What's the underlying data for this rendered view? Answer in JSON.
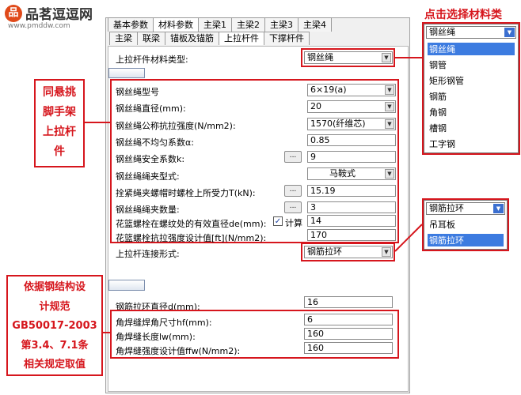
{
  "brand": {
    "badge": "品",
    "title": "品茗逗逗网",
    "url": "www.pmddw.com"
  },
  "tabs_top": [
    "基本参数",
    "材料参数",
    "主梁1",
    "主梁2",
    "主梁3",
    "主梁4"
  ],
  "tabs_sub": [
    "主梁",
    "联梁",
    "锚板及锚筋",
    "上拉杆件",
    "下撑杆件"
  ],
  "form": {
    "material_type_label": "上拉杆件材料类型:",
    "material_type_value": "钢丝绳",
    "rope_model_label": "钢丝绳型号",
    "rope_model_value": "6×19(a)",
    "rope_diameter_label": "钢丝绳直径(mm):",
    "rope_diameter_value": "20",
    "rope_strength_label": "钢丝绳公称抗拉强度(N/mm2):",
    "rope_strength_value": "1570(纤维芯)",
    "uneven_label": "钢丝绳不均匀系数α:",
    "uneven_value": "0.85",
    "safety_label": "钢丝绳安全系数k:",
    "safety_value": "9",
    "clamp_type_label": "钢丝绳绳夹型式:",
    "clamp_type_value": "马鞍式",
    "tension_label": "拴紧绳夹螺帽时螺栓上所受力T(kN):",
    "tension_value": "15.19",
    "clamp_count_label": "钢丝绳绳夹数量:",
    "clamp_count_value": "3",
    "thread_dia_label": "花篮螺栓在螺纹处的有效直径de(mm):",
    "calc_label": "计算",
    "thread_dia_value": "14",
    "bolt_strength_label": "花篮螺栓抗拉强度设计值[ft](N/mm2):",
    "bolt_strength_value": "170",
    "connect_label": "上拉杆连接形式:",
    "connect_value": "钢筋拉环",
    "dots": "...",
    "ring_dia_label": "钢筋拉环直径d(mm):",
    "ring_dia_value": "16",
    "weld_size_label": "角焊缝焊角尺寸hf(mm):",
    "weld_size_value": "6",
    "weld_len_label": "角焊缝长度lw(mm):",
    "weld_len_value": "160",
    "weld_strength_label": "角焊缝强度设计值ffw(N/mm2):",
    "weld_strength_value": "160"
  },
  "callouts": {
    "select_material": "点击选择材料类",
    "left_top": [
      "同悬挑",
      "脚手架",
      "上拉杆",
      "件"
    ],
    "left_bottom": [
      "依据钢结构设",
      "计规范",
      "GB50017-2003",
      "第3.4、7.1条",
      "相关规定取值"
    ]
  },
  "material_dropdown": {
    "current": "钢丝绳",
    "options": [
      "钢丝绳",
      "钢管",
      "矩形钢管",
      "钢筋",
      "角钢",
      "槽钢",
      "工字钢"
    ]
  },
  "connect_dropdown": {
    "current": "钢筋拉环",
    "options": [
      "吊耳板",
      "钢筋拉环"
    ]
  },
  "colors": {
    "accent_red": "#d6161d",
    "selection_blue": "#3c7be0"
  }
}
